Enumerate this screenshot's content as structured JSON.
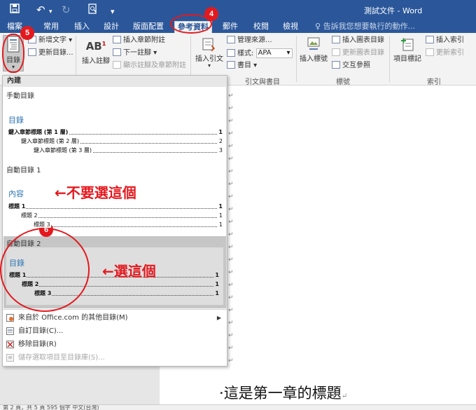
{
  "window": {
    "title": "測試文件 - Word"
  },
  "tabs": [
    {
      "label": "檔案"
    },
    {
      "label": "常用"
    },
    {
      "label": "插入"
    },
    {
      "label": "設計"
    },
    {
      "label": "版面配置"
    },
    {
      "label": "參考資料"
    },
    {
      "label": "郵件"
    },
    {
      "label": "校閱"
    },
    {
      "label": "檢視"
    }
  ],
  "tell_me": "告訴我您想要執行的動作...",
  "ribbon": {
    "toc_button": "目錄",
    "add_text": "新增文字",
    "update_toc": "更新目錄...",
    "insert_footnote": "插入註腳",
    "insert_endnote": "插入章節附註",
    "next_footnote": "下一註腳",
    "show_notes": "顯示註腳及章節附註",
    "insert_citation": "插入引文",
    "manage_sources": "管理來源...",
    "style_label": "樣式:",
    "style_value": "APA",
    "bibliography": "書目",
    "group_citations": "引文與書目",
    "insert_caption": "插入標號",
    "insert_table_of_figures": "插入圖表目錄",
    "update_table": "更新圖表目錄",
    "cross_reference": "交互參照",
    "group_captions": "標號",
    "mark_entry": "項目標記",
    "insert_index": "插入索引",
    "update_index": "更新索引",
    "group_index": "索引"
  },
  "dropdown": {
    "header": "內建",
    "manual": {
      "label": "手動目錄",
      "title": "目錄",
      "lines": [
        {
          "text": "鍵入章節標題 (第 1 層)",
          "page": "1"
        },
        {
          "text": "鍵入章節標題 (第 2 層)",
          "page": "2"
        },
        {
          "text": "鍵入章節標題 (第 3 層)",
          "page": "3"
        }
      ]
    },
    "auto1": {
      "label": "自動目錄 1",
      "title": "內容",
      "lines": [
        {
          "text": "標題 1",
          "page": "1"
        },
        {
          "text": "標題 2",
          "page": "1"
        },
        {
          "text": "標題 3",
          "page": "1"
        }
      ]
    },
    "auto2": {
      "label": "自動目錄 2",
      "title": "目錄",
      "lines": [
        {
          "text": "標題 1",
          "page": "1"
        },
        {
          "text": "標題 2",
          "page": "1"
        },
        {
          "text": "標題 3",
          "page": "1"
        }
      ]
    },
    "menu": [
      {
        "label": "來自於 Office.com 的其他目錄(M)"
      },
      {
        "label": "自訂目錄(C)..."
      },
      {
        "label": "移除目錄(R)"
      },
      {
        "label": "儲存選取項目至目錄庫(S)..."
      }
    ]
  },
  "document": {
    "heading": "這是第一章的標題"
  },
  "statusbar": {
    "text": "第 2 頁，共 5 頁    595 個字    中文(台灣)"
  },
  "annotations": {
    "badges": [
      "4",
      "5",
      "6"
    ],
    "dont_select": "←不要選這個",
    "select_this": "←選這個",
    "color": "#e3191e"
  }
}
